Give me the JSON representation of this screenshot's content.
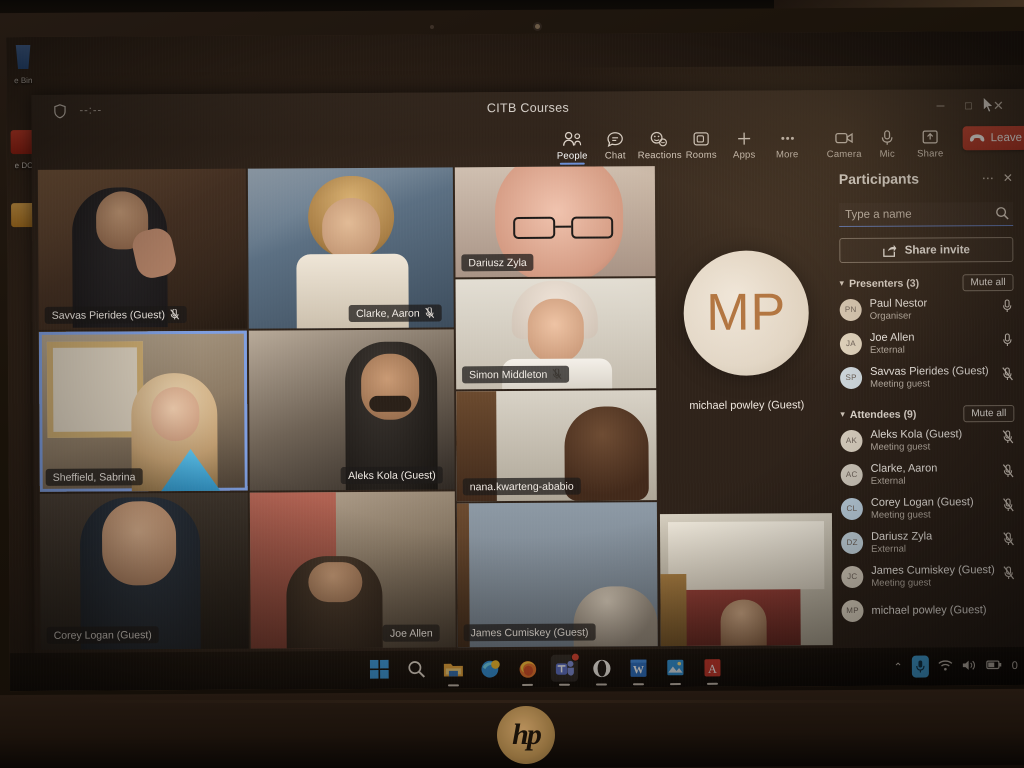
{
  "desktop": {
    "icons": [
      {
        "label": "e Bin",
        "glyph": "recycle-bin-icon"
      },
      {
        "label": "e\nDC",
        "glyph": "acrobat-reader-icon"
      }
    ]
  },
  "window": {
    "title": "CITB Courses",
    "timer": "--:--",
    "shield_icon": "shield-icon",
    "controls": {
      "minimize": "─",
      "maximize": "□",
      "close": "✕"
    }
  },
  "toolbar": {
    "items": [
      {
        "label": "People",
        "icon": "people-icon",
        "active": true
      },
      {
        "label": "Chat",
        "icon": "chat-icon",
        "active": false
      },
      {
        "label": "Reactions",
        "icon": "reactions-icon",
        "active": false
      },
      {
        "label": "Rooms",
        "icon": "rooms-icon",
        "active": false
      },
      {
        "label": "Apps",
        "icon": "apps-plus-icon",
        "active": false
      },
      {
        "label": "More",
        "icon": "more-ellipsis-icon",
        "active": false
      }
    ],
    "right_items": [
      {
        "label": "Camera",
        "icon": "camera-icon"
      },
      {
        "label": "Mic",
        "icon": "microphone-icon"
      },
      {
        "label": "Share",
        "icon": "share-screen-icon"
      }
    ],
    "leave": {
      "label": "Leave",
      "icon": "hangup-icon",
      "chevron": "⌄",
      "color": "#c8402f"
    }
  },
  "stage": {
    "tiles": [
      {
        "name": "Savvas Pierides (Guest)",
        "muted": true,
        "speaking": false
      },
      {
        "name": "Clarke, Aaron",
        "muted": true,
        "speaking": false
      },
      {
        "name": "Dariusz Zyla",
        "muted": false,
        "speaking": false
      },
      {
        "name": "Simon Middleton",
        "muted": true,
        "speaking": false
      },
      {
        "name": "Sheffield, Sabrina",
        "muted": false,
        "speaking": true
      },
      {
        "name": "Aleks Kola (Guest)",
        "muted": false,
        "speaking": false
      },
      {
        "name": "nana.kwarteng-ababio",
        "muted": false,
        "speaking": false
      },
      {
        "name": "Corey Logan (Guest)",
        "muted": false,
        "speaking": false
      },
      {
        "name": "Joe Allen",
        "muted": false,
        "speaking": false
      },
      {
        "name": "James Cumiskey (Guest)",
        "muted": false,
        "speaking": false
      },
      {
        "name": "",
        "muted": false,
        "speaking": false
      }
    ],
    "spotlight": {
      "initials": "MP",
      "name": "michael powley (Guest)"
    }
  },
  "participants": {
    "title": "Participants",
    "more_icon": "more-ellipsis-icon",
    "close_icon": "close-icon",
    "search": {
      "placeholder": "Type a name",
      "value": "",
      "icon": "search-icon"
    },
    "share_invite": {
      "label": "Share invite",
      "icon": "share-invite-icon"
    },
    "groups": [
      {
        "label": "Presenters (3)",
        "mute_all": "Mute all",
        "people": [
          {
            "initials": "PN",
            "name": "Paul Nestor",
            "role": "Organiser",
            "mic": "mic-on-icon",
            "avatar_color": "#d8c9b4"
          },
          {
            "initials": "JA",
            "name": "Joe Allen",
            "role": "External",
            "mic": "mic-on-icon",
            "avatar_color": "#e0d3bd"
          },
          {
            "initials": "SP",
            "name": "Savvas Pierides (Guest)",
            "role": "Meeting guest",
            "mic": "mic-off-icon",
            "avatar_color": "#cfd8dd"
          }
        ]
      },
      {
        "label": "Attendees (9)",
        "mute_all": "Mute all",
        "people": [
          {
            "initials": "AK",
            "name": "Aleks Kola (Guest)",
            "role": "Meeting guest",
            "mic": "mic-off-icon",
            "avatar_color": "#dcd2c2"
          },
          {
            "initials": "AC",
            "name": "Clarke, Aaron",
            "role": "External",
            "mic": "mic-off-icon",
            "avatar_color": "#d5cdc0"
          },
          {
            "initials": "CL",
            "name": "Corey Logan (Guest)",
            "role": "Meeting guest",
            "mic": "mic-off-icon",
            "avatar_color": "#bfd3e2"
          },
          {
            "initials": "DZ",
            "name": "Dariusz Zyla",
            "role": "External",
            "mic": "mic-off-icon",
            "avatar_color": "#c6d6e0"
          },
          {
            "initials": "JC",
            "name": "James Cumiskey (Guest)",
            "role": "Meeting guest",
            "mic": "mic-off-icon",
            "avatar_color": "#dad0c0"
          },
          {
            "initials": "MP",
            "name": "michael powley (Guest)",
            "role": "",
            "mic": "",
            "avatar_color": "#e2d8c6"
          }
        ]
      }
    ]
  },
  "taskbar": {
    "apps": [
      {
        "name": "start-button",
        "icon": "windows-logo-icon",
        "open": false,
        "badge": false
      },
      {
        "name": "search-button",
        "icon": "search-icon",
        "open": false,
        "badge": false
      },
      {
        "name": "file-explorer",
        "icon": "folder-icon",
        "open": true,
        "badge": false
      },
      {
        "name": "microsoft-edge",
        "icon": "edge-icon",
        "open": false,
        "badge": false
      },
      {
        "name": "firefox",
        "icon": "firefox-icon",
        "open": true,
        "badge": false
      },
      {
        "name": "microsoft-teams",
        "icon": "teams-icon",
        "open": true,
        "badge": true
      },
      {
        "name": "opera",
        "icon": "opera-icon",
        "open": true,
        "badge": false
      },
      {
        "name": "microsoft-word",
        "icon": "word-icon",
        "open": true,
        "badge": false
      },
      {
        "name": "photos",
        "icon": "photos-icon",
        "open": true,
        "badge": false
      },
      {
        "name": "adobe-reader",
        "icon": "adobe-reader-icon",
        "open": true,
        "badge": false
      }
    ],
    "tray": {
      "chevron": "⌃",
      "mic": "microphone-icon",
      "wifi": "wifi-icon",
      "volume": "volume-icon",
      "battery": "battery-icon",
      "clock": "0"
    }
  },
  "laptop": {
    "brand": "hp"
  }
}
